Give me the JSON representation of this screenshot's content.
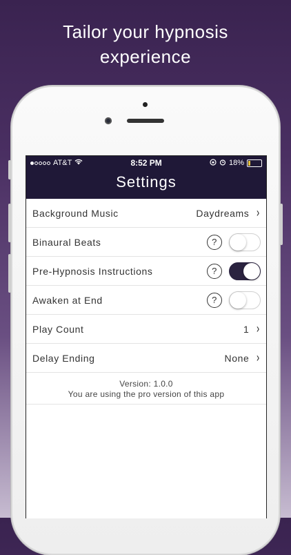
{
  "headline": [
    "Tailor your hypnosis",
    "experience"
  ],
  "status_bar": {
    "carrier": "AT&T",
    "time": "8:52 PM",
    "battery": "18%"
  },
  "nav_title": "Settings",
  "rows": [
    {
      "label": "Background Music",
      "value": "Daydreams"
    },
    {
      "label": "Binaural Beats",
      "toggle": false
    },
    {
      "label": "Pre-Hypnosis Instructions",
      "toggle": true
    },
    {
      "label": "Awaken at End",
      "toggle": false
    },
    {
      "label": "Play Count",
      "value": "1"
    },
    {
      "label": "Delay Ending",
      "value": "None"
    }
  ],
  "version": {
    "line1": "Version: 1.0.0",
    "line2": "You are using the pro version of this app"
  },
  "icons": {
    "help": "?",
    "chevron": "›"
  },
  "colors": {
    "nav_background": "#1f1837",
    "toggle_on": "#2b2340",
    "battery_fill": "#e6c23a"
  }
}
